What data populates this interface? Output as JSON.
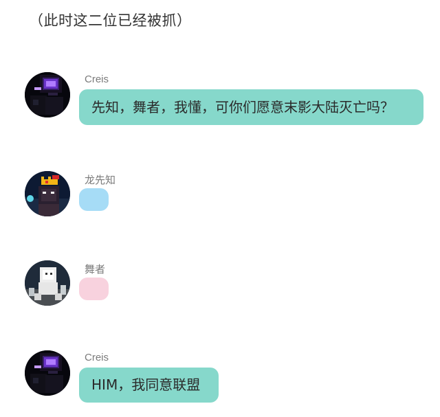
{
  "narration": "（此时这二位已经被抓）",
  "messages": [
    {
      "sender": "Creis",
      "avatar_icon": "enderman-avatar-icon",
      "text": "先知，舞者，我懂，可你们愿意末影大陆灭亡吗？",
      "bubble_color": "#86d8cb"
    },
    {
      "sender": "龙先知",
      "avatar_icon": "crowned-figure-avatar-icon",
      "text": "",
      "bubble_color": "#a6dcf6"
    },
    {
      "sender": "舞者",
      "avatar_icon": "white-figure-avatar-icon",
      "text": "",
      "bubble_color": "#f8d2de"
    },
    {
      "sender": "Creis",
      "avatar_icon": "enderman-avatar-icon",
      "text": "HIM，我同意联盟",
      "bubble_color": "#86d8cb"
    }
  ]
}
